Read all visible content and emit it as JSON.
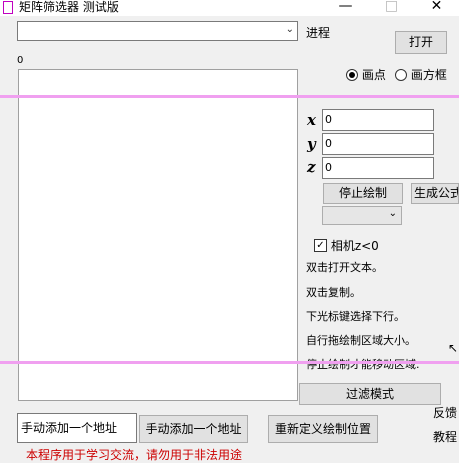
{
  "window": {
    "title": "矩阵筛选器 测试版",
    "minimize_glyph": "—",
    "maximize_glyph": "□",
    "close_glyph": "✕",
    "icon": "app-window-icon"
  },
  "top": {
    "process_combo_value": "",
    "process_label": "进程",
    "open_button": "打开",
    "count_label": "0"
  },
  "mode": {
    "draw_point": "画点",
    "draw_box": "画方框",
    "selected": "draw_point"
  },
  "coords": {
    "x_label": "x",
    "y_label": "y",
    "z_label": "z",
    "x_value": "0",
    "y_value": "0",
    "z_value": "0"
  },
  "actions": {
    "stop_draw": "停止绘制",
    "gen_formula": "生成公式",
    "formula_select_value": ""
  },
  "options": {
    "camera_check_label": "相机z<0",
    "camera_checked": true
  },
  "tips": [
    "双击打开文本。",
    "双击复制。",
    "下光标键选择下行。",
    "自行拖绘制区域大小。",
    "停止绘制才能移动区域."
  ],
  "bottom": {
    "filter_mode": "过滤模式",
    "manual_add_input": "手动添加一个地址",
    "manual_add_button": "手动添加一个地址",
    "redefine_button": "重新定义绘制位置",
    "feedback": "反馈",
    "tutorial": "教程",
    "disclaimer": "本程序用于学习交流，请勿用于非法用途"
  },
  "colors": {
    "guide_line": "#f0a0f0",
    "disclaimer": "#cc0000",
    "app_icon_border": "#c000c0"
  }
}
